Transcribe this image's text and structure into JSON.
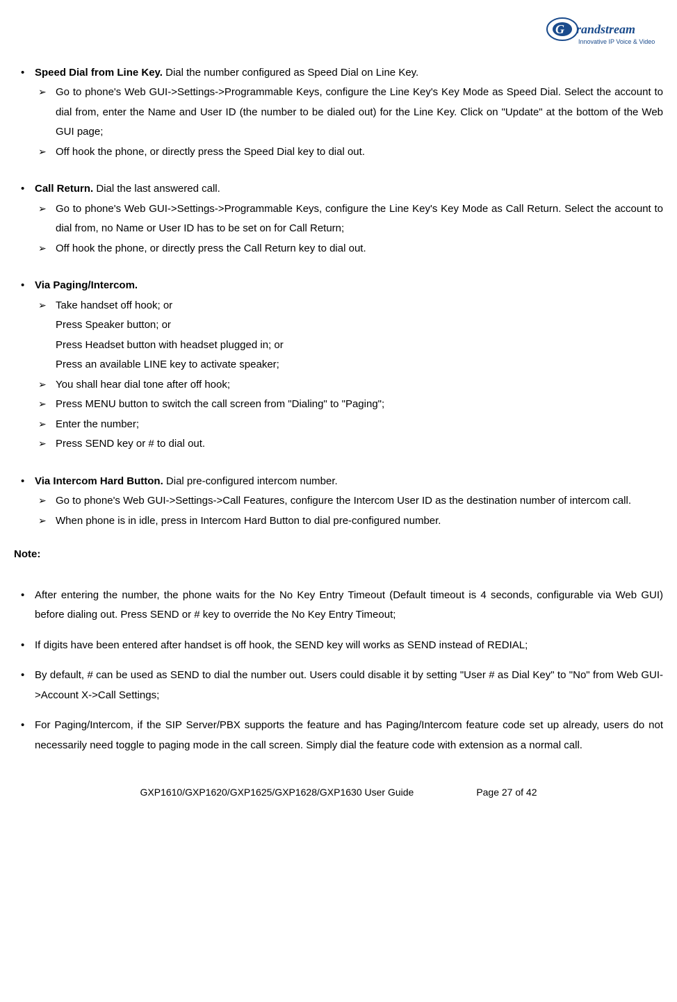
{
  "logo": {
    "brand": "Grandstream",
    "tagline": "Innovative IP Voice & Video"
  },
  "sections": [
    {
      "title": "Speed Dial from Line Key.",
      "desc": " Dial the number configured as Speed Dial on Line Key.",
      "subs": [
        "Go to phone's Web GUI->Settings->Programmable Keys, configure the Line Key's Key Mode as Speed Dial. Select the account to dial from, enter the Name and User ID (the number to be dialed out) for the Line Key. Click on \"Update\" at the bottom of the Web GUI page;",
        "Off hook the phone, or directly press the Speed Dial key to dial out."
      ]
    },
    {
      "title": "Call Return.",
      "desc": " Dial the last answered call.",
      "subs": [
        "Go to phone's Web GUI->Settings->Programmable Keys, configure the Line Key's Key Mode as Call Return. Select the account to dial from, no Name or User ID has to be set on for Call Return;",
        "Off hook the phone, or directly press the Call Return key to dial out."
      ]
    },
    {
      "title": "Via Paging/Intercom.",
      "desc": "",
      "subs": [
        "Take handset off hook; or",
        "You shall hear dial tone after off hook;",
        "Press MENU button to switch the call screen from \"Dialing\" to \"Paging\";",
        "Enter the number;",
        "Press SEND key or # to dial out."
      ],
      "extra_lines": [
        "Press Speaker button; or",
        "Press Headset button with headset plugged in; or",
        "Press an available LINE key to activate speaker;"
      ]
    },
    {
      "title": "Via Intercom Hard Button.",
      "desc": " Dial pre-configured intercom number.",
      "subs": [
        "Go to phone's Web GUI->Settings->Call Features, configure the Intercom User ID as the destination number of intercom call.",
        "When phone is in idle, press in Intercom Hard Button to dial pre-configured number."
      ]
    }
  ],
  "note_label": "Note:",
  "notes": [
    "After entering the number, the phone waits for the No Key Entry Timeout (Default timeout is 4 seconds, configurable via Web GUI) before dialing out. Press SEND or # key to override the No Key Entry Timeout;",
    "If digits have been entered after handset is off hook, the SEND key will works as SEND instead of REDIAL;",
    "By default, # can be used as SEND to dial the number out. Users could disable it by setting \"User # as Dial Key\" to \"No\" from Web GUI->Account X->Call Settings;",
    "For Paging/Intercom, if the SIP Server/PBX supports the feature and has Paging/Intercom feature code set up already, users do not necessarily need toggle to paging mode in the call screen. Simply dial the feature code with extension as a normal call."
  ],
  "footer": {
    "left": "GXP1610/GXP1620/GXP1625/GXP1628/GXP1630 User Guide",
    "right": "Page 27 of 42"
  }
}
